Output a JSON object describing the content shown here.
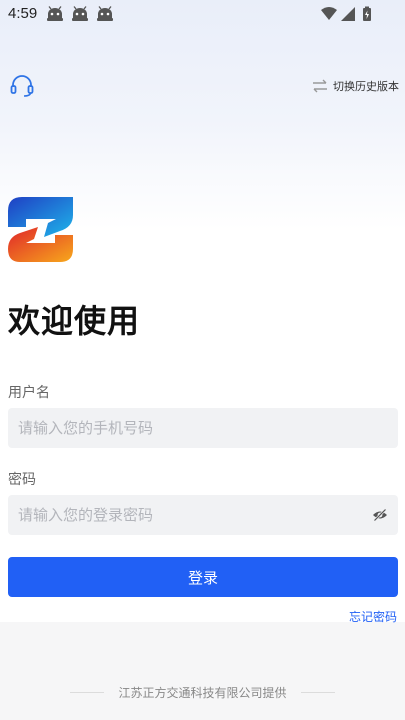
{
  "status_bar": {
    "time": "4:59",
    "app_icons": [
      "android-app-icon",
      "android-app-icon",
      "android-app-icon"
    ],
    "right_icons": [
      "wifi-icon",
      "signal-icon",
      "battery-icon"
    ]
  },
  "header": {
    "support_icon": "headset-icon",
    "switch_label": "切换历史版本",
    "switch_icon": "swap-arrows-icon"
  },
  "logo": {
    "icon": "z-logo-icon",
    "colors": [
      "#1a63d8",
      "#1fb1e6",
      "#f5a019",
      "#d8332b"
    ]
  },
  "welcome_title": "欢迎使用",
  "form": {
    "username_label": "用户名",
    "username_placeholder": "请输入您的手机号码",
    "password_label": "密码",
    "password_placeholder": "请输入您的登录密码",
    "eye_icon": "eye-hidden-icon",
    "login_label": "登录",
    "forgot_label": "忘记密码"
  },
  "footer": {
    "text": "江苏正方交通科技有限公司提供"
  },
  "colors": {
    "accent": "#2160f5",
    "input_bg": "#f1f2f4",
    "bg_top": "#e9eef9"
  }
}
